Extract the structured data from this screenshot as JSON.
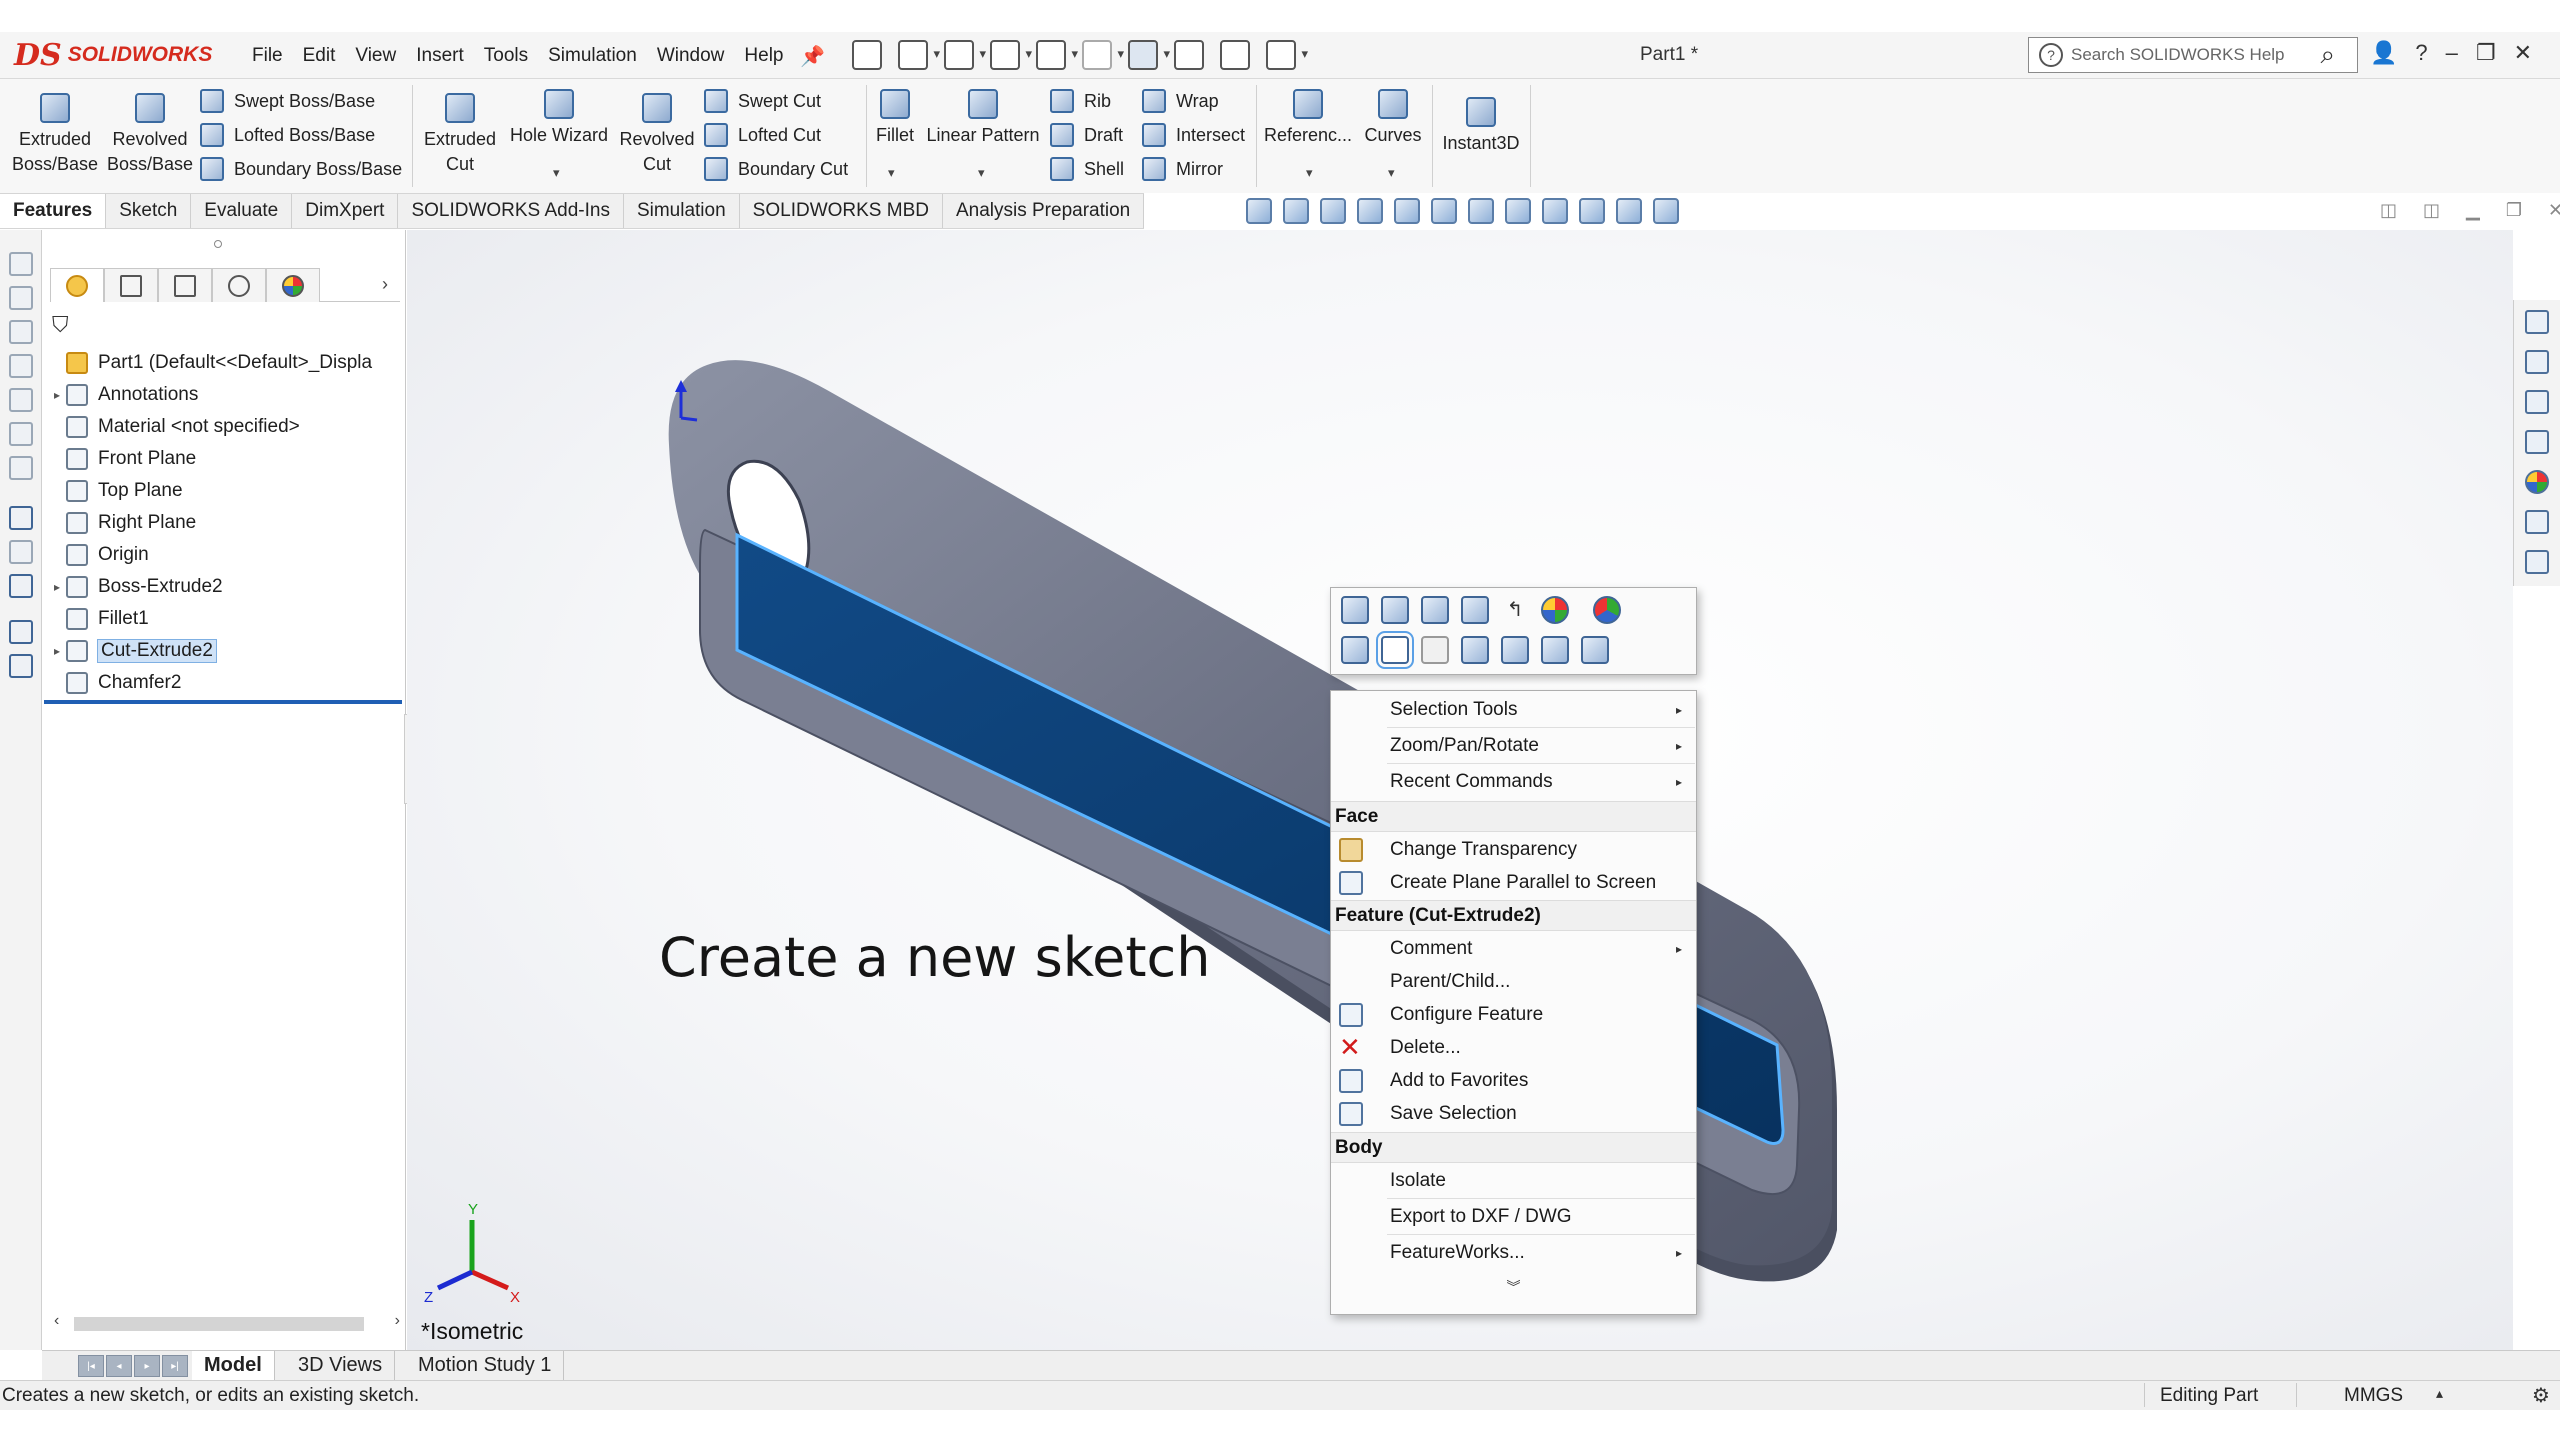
{
  "app": {
    "logo_mark": "DS",
    "logo_text": "SOLIDWORKS",
    "document_title": "Part1 *"
  },
  "menu": [
    "File",
    "Edit",
    "View",
    "Insert",
    "Tools",
    "Simulation",
    "Window",
    "Help"
  ],
  "search": {
    "placeholder": "Search SOLIDWORKS Help"
  },
  "window_controls": {
    "help": "?",
    "minimize": "–",
    "restore": "❐",
    "close": "✕"
  },
  "commands": {
    "extruded_boss": [
      "Extruded",
      "Boss/Base"
    ],
    "revolved_boss": [
      "Revolved",
      "Boss/Base"
    ],
    "swept_boss": "Swept Boss/Base",
    "lofted_boss": "Lofted Boss/Base",
    "boundary_boss": "Boundary Boss/Base",
    "extruded_cut": [
      "Extruded",
      "Cut"
    ],
    "hole_wizard": "Hole Wizard",
    "revolved_cut": [
      "Revolved",
      "Cut"
    ],
    "swept_cut": "Swept Cut",
    "lofted_cut": "Lofted Cut",
    "boundary_cut": "Boundary Cut",
    "fillet": "Fillet",
    "linear_pattern": "Linear Pattern",
    "rib": "Rib",
    "draft": "Draft",
    "shell": "Shell",
    "wrap": "Wrap",
    "intersect": "Intersect",
    "mirror": "Mirror",
    "reference": "Referenc...",
    "curves": "Curves",
    "instant3d": "Instant3D"
  },
  "tabs": [
    "Features",
    "Sketch",
    "Evaluate",
    "DimXpert",
    "SOLIDWORKS Add-Ins",
    "Simulation",
    "SOLIDWORKS MBD",
    "Analysis Preparation"
  ],
  "feature_tree": [
    {
      "label": "Part1  (Default<<Default>_Displa",
      "expand": "",
      "icon": "part-icon"
    },
    {
      "label": "Annotations",
      "expand": "▸",
      "icon": "annotations-icon"
    },
    {
      "label": "Material <not specified>",
      "expand": "",
      "icon": "material-icon"
    },
    {
      "label": "Front Plane",
      "expand": "",
      "icon": "plane-icon"
    },
    {
      "label": "Top Plane",
      "expand": "",
      "icon": "plane-icon"
    },
    {
      "label": "Right Plane",
      "expand": "",
      "icon": "plane-icon"
    },
    {
      "label": "Origin",
      "expand": "",
      "icon": "origin-icon"
    },
    {
      "label": "Boss-Extrude2",
      "expand": "▸",
      "icon": "extrude-icon"
    },
    {
      "label": "Fillet1",
      "expand": "",
      "icon": "fillet-icon"
    },
    {
      "label": "Cut-Extrude2",
      "expand": "▸",
      "icon": "cut-extrude-icon",
      "selected": true
    },
    {
      "label": "Chamfer2",
      "expand": "",
      "icon": "chamfer-icon"
    }
  ],
  "viewport": {
    "annotation": "Create a new sketch",
    "view_name": "*Isometric",
    "triad": {
      "x": "X",
      "y": "Y",
      "z": "Z"
    }
  },
  "context_menu": {
    "items": {
      "selection_tools": "Selection Tools",
      "zoom_pan_rotate": "Zoom/Pan/Rotate",
      "recent_commands": "Recent Commands",
      "change_transparency": "Change Transparency",
      "create_plane": "Create Plane Parallel to Screen",
      "comment": "Comment",
      "parent_child": "Parent/Child...",
      "configure_feature": "Configure Feature",
      "delete": "Delete...",
      "add_favorites": "Add to Favorites",
      "save_selection": "Save Selection",
      "isolate": "Isolate",
      "export_dxf": "Export to DXF / DWG",
      "featureworks": "FeatureWorks..."
    },
    "headers": {
      "face": "Face",
      "feature": "Feature (Cut-Extrude2)",
      "body": "Body"
    },
    "more": "︾"
  },
  "bottom_tabs": [
    "Model",
    "3D Views",
    "Motion Study 1"
  ],
  "status": {
    "message": "Creates a new sketch, or edits an existing sketch.",
    "mode": "Editing Part",
    "units": "MMGS",
    "units_arrow": "▴"
  },
  "colors": {
    "accent": "#1f5fb4",
    "logo_red": "#d52b1e",
    "model_body": "#6f7588",
    "selected_face": "#0c3b6e"
  }
}
